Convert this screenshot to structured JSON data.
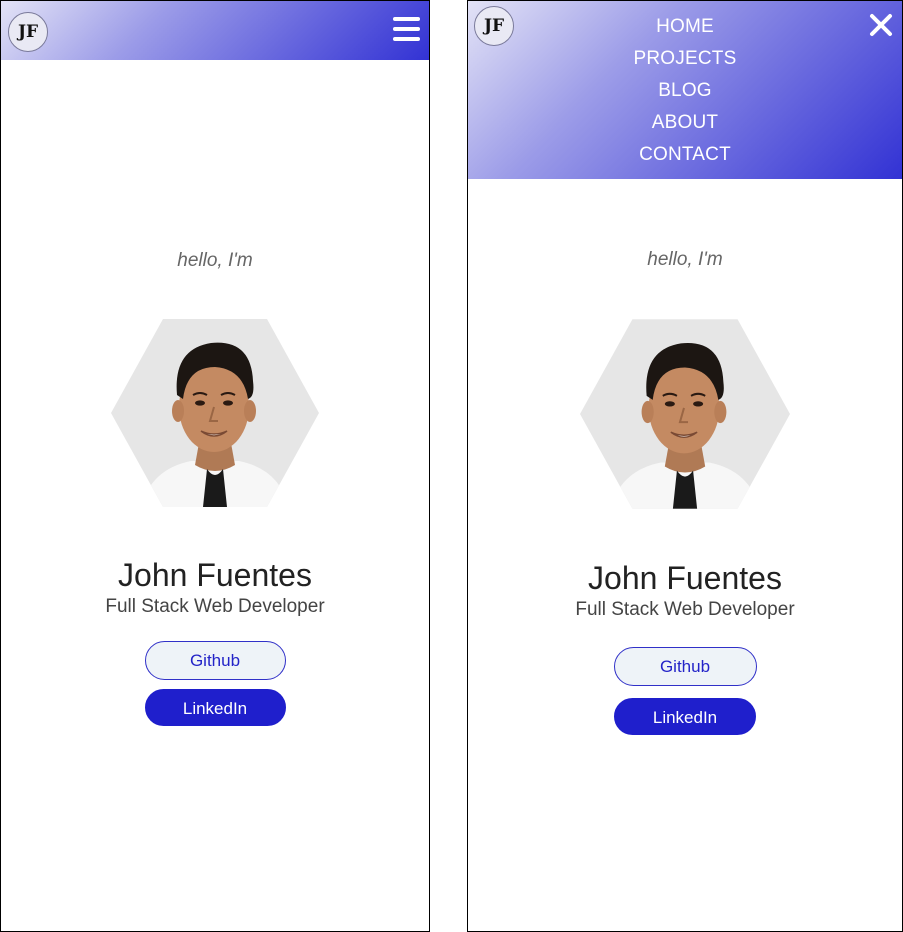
{
  "logo": {
    "initials": "JF"
  },
  "nav": {
    "items": [
      {
        "label": "HOME"
      },
      {
        "label": "PROJECTS"
      },
      {
        "label": "BLOG"
      },
      {
        "label": "ABOUT"
      },
      {
        "label": "CONTACT"
      }
    ]
  },
  "hero": {
    "greeting": "hello, I'm",
    "name": "John Fuentes",
    "role": "Full Stack Web Developer",
    "github_label": "Github",
    "linkedin_label": "LinkedIn"
  },
  "icons": {
    "menu": "hamburger-menu-icon",
    "close": "close-icon"
  },
  "colors": {
    "accent": "#1f1fcc",
    "header_gradient_start": "#e3e3f6",
    "header_gradient_end": "#3232d4",
    "github_bg": "#eef3f8"
  }
}
